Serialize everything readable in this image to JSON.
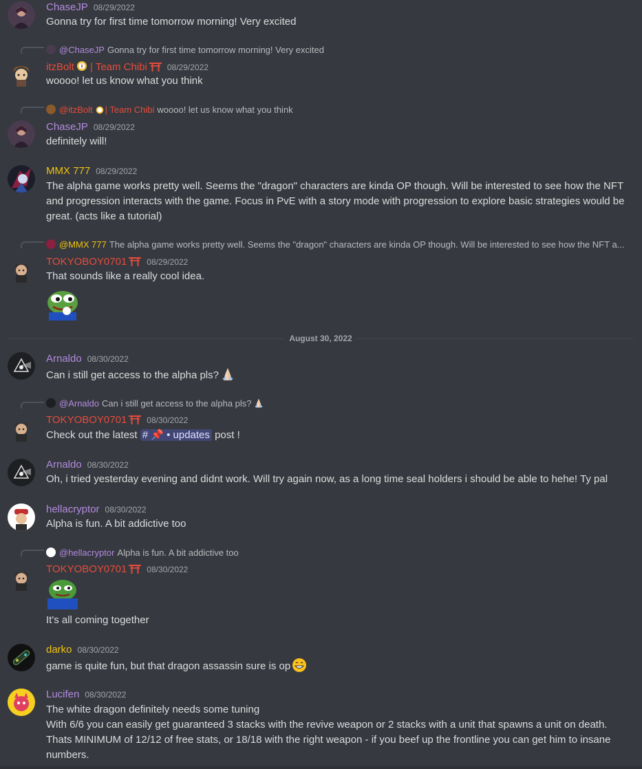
{
  "colors": {
    "purple": "#b38be0",
    "red": "#e74c3c",
    "gold": "#f1c40f",
    "mention_bg": "#414675"
  },
  "divider": {
    "label": "August 30, 2022"
  },
  "messages": [
    {
      "user": "ChaseJP",
      "time": "08/29/2022",
      "text": "Gonna try for first time tomorrow morning! Very excited"
    },
    {
      "reply_user": "@ChaseJP",
      "reply_text": "Gonna try for first time tomorrow morning! Very excited",
      "user": "itzBolt",
      "user_suffix": "| Team Chibi",
      "time": "08/29/2022",
      "text": "woooo! let us know what you think"
    },
    {
      "reply_user": "@itzBolt",
      "reply_user_suffix": "| Team Chibi",
      "reply_text": "woooo! let us know what you think",
      "user": "ChaseJP",
      "time": "08/29/2022",
      "text": "definitely will!"
    },
    {
      "user": "MMX 777",
      "time": "08/29/2022",
      "text": "The alpha game works pretty well.  Seems the \"dragon\" characters are kinda OP though. Will be interested to see how the NFT and progression interacts with the game.  Focus in  PvE with a story mode with progression to explore basic strategies would be great.  (acts like a tutorial)"
    },
    {
      "reply_user": "@MMX 777",
      "reply_text": "The alpha game works pretty well.  Seems the \"dragon\" characters are kinda OP though. Will be interested to see how the NFT a...",
      "user": "TOKYOBOY0701",
      "time": "08/29/2022",
      "text": "That sounds like a really cool idea."
    },
    {
      "user": "Arnaldo",
      "time": "08/30/2022",
      "text": "Can i still get access to the alpha pls?"
    },
    {
      "reply_user": "@Arnaldo",
      "reply_text": "Can i still get access to the alpha pls?",
      "user": "TOKYOBOY0701",
      "time": "08/30/2022",
      "text_before": "Check out the latest",
      "channel": "# 📌 • updates",
      "text_after": "post !"
    },
    {
      "user": "Arnaldo",
      "time": "08/30/2022",
      "text": "Oh, i tried yesterday evening and didnt work. Will try again now, as a long time seal holders i should be able to hehe! Ty pal"
    },
    {
      "user": "hellacryptor",
      "time": "08/30/2022",
      "text": "Alpha is fun. A bit addictive too"
    },
    {
      "reply_user": "@hellacryptor",
      "reply_text": "Alpha is fun. A bit addictive too",
      "user": "TOKYOBOY0701",
      "time": "08/30/2022",
      "text": "It's all coming together"
    },
    {
      "user": "darko",
      "time": "08/30/2022",
      "text": "game is quite fun, but that dragon assassin sure is op"
    },
    {
      "user": "Lucifen",
      "time": "08/30/2022",
      "text": "The white dragon definitely needs some tuning\nWith 6/6 you can easily get guaranteed 3 stacks with the revive weapon or 2 stacks with a unit that spawns a unit on death. Thats MINIMUM of 12/12 of free stats, or 18/18 with the right weapon - if you beef up the frontline you can get him to insane numbers."
    }
  ]
}
